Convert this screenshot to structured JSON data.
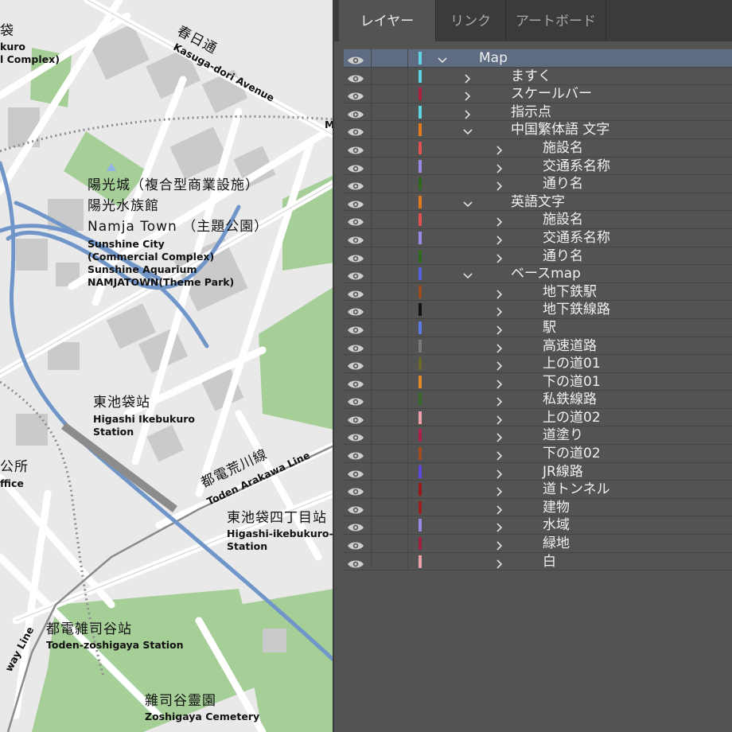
{
  "map": {
    "labels": {
      "kasuga_jp": "春日通",
      "kasuga_en": "Kasuga-dori Avenue",
      "sunshine_jp1": "陽光城（複合型商業設施）",
      "sunshine_jp2": "陽光水族館",
      "sunshine_jp3": "Namja Town （主題公園）",
      "sunshine_en1": "Sunshine City",
      "sunshine_en2": "(Commercial Complex)",
      "sunshine_en3": "Sunshine Aquarium",
      "sunshine_en4": "NAMJATOWN(Theme Park)",
      "higashi_jp": "東池袋站",
      "higashi_en1": "Higashi Ikebukuro",
      "higashi_en2": "Station",
      "arakawa_jp": "都電荒川線",
      "arakawa_en": "Toden Arakawa Line",
      "yonchome_jp": "東池袋四丁目站",
      "yonchome_en1": "Higashi-ikebukuro-",
      "yonchome_en2": "Station",
      "zoshigaya_st_jp": "都電雑司谷站",
      "zoshigaya_st_en": "Toden-zoshigaya Station",
      "cemetery_jp": "雜司谷靈園",
      "cemetery_en": "Zoshigaya Cemetery",
      "edge_fukuro": "袋",
      "edge_kuro": "kuro",
      "edge_complex": "l Complex)",
      "edge_office_jp": "公所",
      "edge_office_en": "ffice",
      "edge_subway": "way Line",
      "edge_m": "M"
    }
  },
  "panel": {
    "tabs": [
      "レイヤー",
      "リンク",
      "アートボード"
    ],
    "active_tab": 0,
    "layers": [
      {
        "name": "Map",
        "level": 0,
        "expanded": true,
        "color": "#5fd4e6",
        "selected": true
      },
      {
        "name": "ますく",
        "level": 1,
        "expanded": false,
        "color": "#5fd4e6"
      },
      {
        "name": "スケールバー",
        "level": 1,
        "expanded": false,
        "color": "#b0203a"
      },
      {
        "name": "指示点",
        "level": 1,
        "expanded": false,
        "color": "#5fd4e6"
      },
      {
        "name": "中国繁体語 文字",
        "level": 1,
        "expanded": true,
        "color": "#e07a1a"
      },
      {
        "name": "施設名",
        "level": 2,
        "expanded": false,
        "color": "#e05050"
      },
      {
        "name": "交通系名称",
        "level": 2,
        "expanded": false,
        "color": "#9a8ae6"
      },
      {
        "name": "通り名",
        "level": 2,
        "expanded": false,
        "color": "#2f6b1e"
      },
      {
        "name": "英語文字",
        "level": 1,
        "expanded": true,
        "color": "#e07a1a"
      },
      {
        "name": "施設名",
        "level": 2,
        "expanded": false,
        "color": "#e05050"
      },
      {
        "name": "交通系名称",
        "level": 2,
        "expanded": false,
        "color": "#9a8ae6"
      },
      {
        "name": "通り名",
        "level": 2,
        "expanded": false,
        "color": "#2f6b1e"
      },
      {
        "name": "ベースmap",
        "level": 1,
        "expanded": true,
        "color": "#5060e0"
      },
      {
        "name": "地下鉄駅",
        "level": 2,
        "expanded": false,
        "color": "#a04a20"
      },
      {
        "name": "地下鉄線路",
        "level": 2,
        "expanded": false,
        "color": "#111111"
      },
      {
        "name": "駅",
        "level": 2,
        "expanded": false,
        "color": "#5a7ae6"
      },
      {
        "name": "高速道路",
        "level": 2,
        "expanded": false,
        "color": "#7a7a7a"
      },
      {
        "name": "上の道01",
        "level": 2,
        "expanded": false,
        "color": "#6a6a2a"
      },
      {
        "name": "下の道01",
        "level": 2,
        "expanded": false,
        "color": "#e08a2a"
      },
      {
        "name": "私鉄線路",
        "level": 2,
        "expanded": false,
        "color": "#3a6a2a"
      },
      {
        "name": "上の道02",
        "level": 2,
        "expanded": false,
        "color": "#f0a0a8"
      },
      {
        "name": "道塗り",
        "level": 2,
        "expanded": false,
        "color": "#b02048"
      },
      {
        "name": "下の道02",
        "level": 2,
        "expanded": false,
        "color": "#a04a20"
      },
      {
        "name": "JR線路",
        "level": 2,
        "expanded": false,
        "color": "#5a4ae0"
      },
      {
        "name": "道トンネル",
        "level": 2,
        "expanded": false,
        "color": "#9a1a1a"
      },
      {
        "name": "建物",
        "level": 2,
        "expanded": false,
        "color": "#a02020"
      },
      {
        "name": "水域",
        "level": 2,
        "expanded": false,
        "color": "#9a8ae6"
      },
      {
        "name": "緑地",
        "level": 2,
        "expanded": false,
        "color": "#a02040"
      },
      {
        "name": "白",
        "level": 2,
        "expanded": false,
        "color": "#f0a0a8"
      }
    ]
  }
}
